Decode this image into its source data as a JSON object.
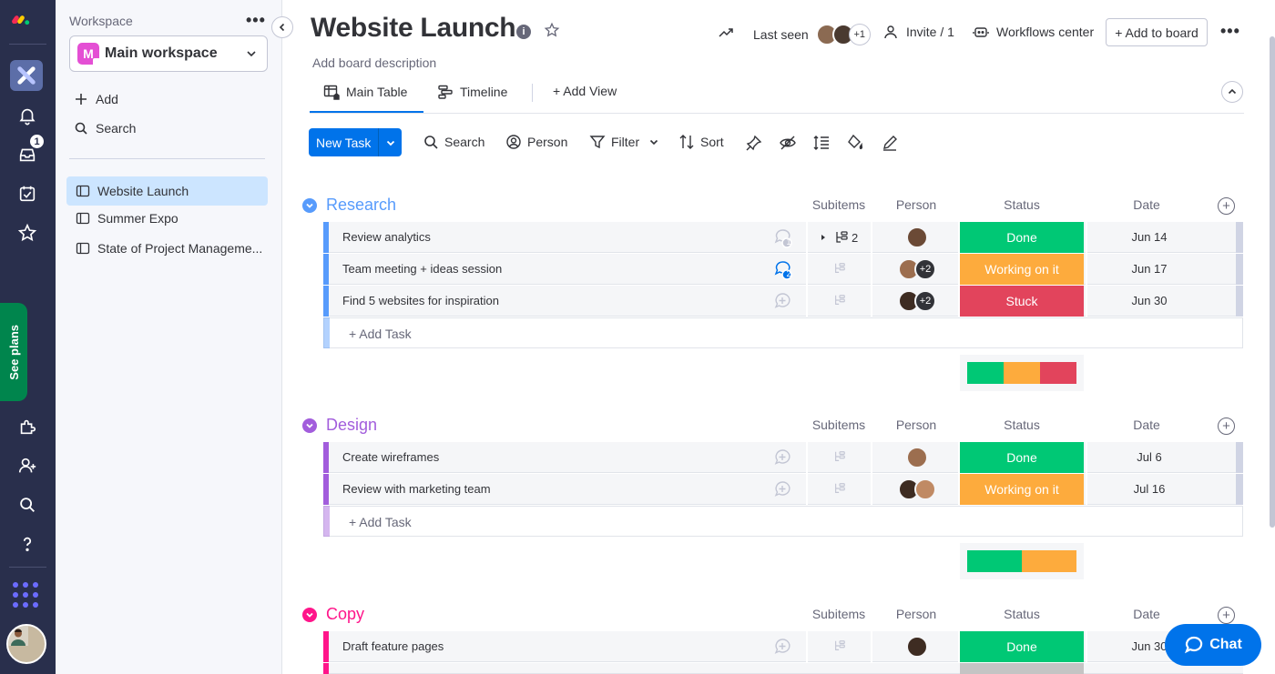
{
  "sidebar": {
    "workspace_label": "Workspace",
    "more": "•••",
    "workspace_initial": "M",
    "workspace_name": "Main workspace",
    "add": "Add",
    "search": "Search",
    "boards": [
      {
        "label": "Website Launch"
      },
      {
        "label": "Summer Expo"
      },
      {
        "label": "State of Project Manageme..."
      }
    ],
    "inbox_badge": "1",
    "see_plans": "See plans"
  },
  "header": {
    "title": "Website Launch",
    "info": "i",
    "description": "Add board description",
    "last_seen": "Last seen",
    "last_seen_more": "+1",
    "invite": "Invite / 1",
    "workflows": "Workflows center",
    "add_to_board": "+ Add to board",
    "more": "•••"
  },
  "tabs": [
    {
      "label": "Main Table"
    },
    {
      "label": "Timeline"
    },
    {
      "label": "+ Add View"
    }
  ],
  "toolbar": {
    "new_task": "New Task",
    "search": "Search",
    "person": "Person",
    "filter": "Filter",
    "sort": "Sort"
  },
  "columns": {
    "subitems": "Subitems",
    "person": "Person",
    "status": "Status",
    "date": "Date"
  },
  "groups": [
    {
      "title": "Research",
      "color": "#579bfc",
      "rows": [
        {
          "name": "Review analytics",
          "updates": "1",
          "subitems": "2",
          "people_extra": "",
          "status": "Done",
          "status_color": "#00c875",
          "date": "Jun 14"
        },
        {
          "name": "Team meeting + ideas session",
          "updates": "2",
          "subitems": "",
          "people_extra": "+2",
          "status": "Working on it",
          "status_color": "#fdab3d",
          "date": "Jun 17"
        },
        {
          "name": "Find 5 websites for inspiration",
          "updates": "",
          "subitems": "",
          "people_extra": "+2",
          "status": "Stuck",
          "status_color": "#e2445c",
          "date": "Jun 30"
        }
      ],
      "add_task": "+ Add Task",
      "summary": [
        {
          "color": "#00c875",
          "fraction": 0.333
        },
        {
          "color": "#fdab3d",
          "fraction": 0.333
        },
        {
          "color": "#e2445c",
          "fraction": 0.334
        }
      ]
    },
    {
      "title": "Design",
      "color": "#a25ddc",
      "rows": [
        {
          "name": "Create wireframes",
          "updates": "",
          "subitems": "",
          "people_extra": "",
          "status": "Done",
          "status_color": "#00c875",
          "date": "Jul 6"
        },
        {
          "name": "Review with marketing team",
          "updates": "",
          "subitems": "",
          "people_extra": "",
          "status": "Working on it",
          "status_color": "#fdab3d",
          "date": "Jul 16"
        }
      ],
      "add_task": "+ Add Task",
      "summary": [
        {
          "color": "#00c875",
          "fraction": 0.5
        },
        {
          "color": "#fdab3d",
          "fraction": 0.5
        }
      ]
    },
    {
      "title": "Copy",
      "color": "#ff158a",
      "rows": [
        {
          "name": "Draft feature pages",
          "updates": "",
          "subitems": "",
          "people_extra": "",
          "status": "Done",
          "status_color": "#00c875",
          "date": "Jun 30"
        }
      ]
    }
  ],
  "chat": {
    "label": "Chat"
  }
}
